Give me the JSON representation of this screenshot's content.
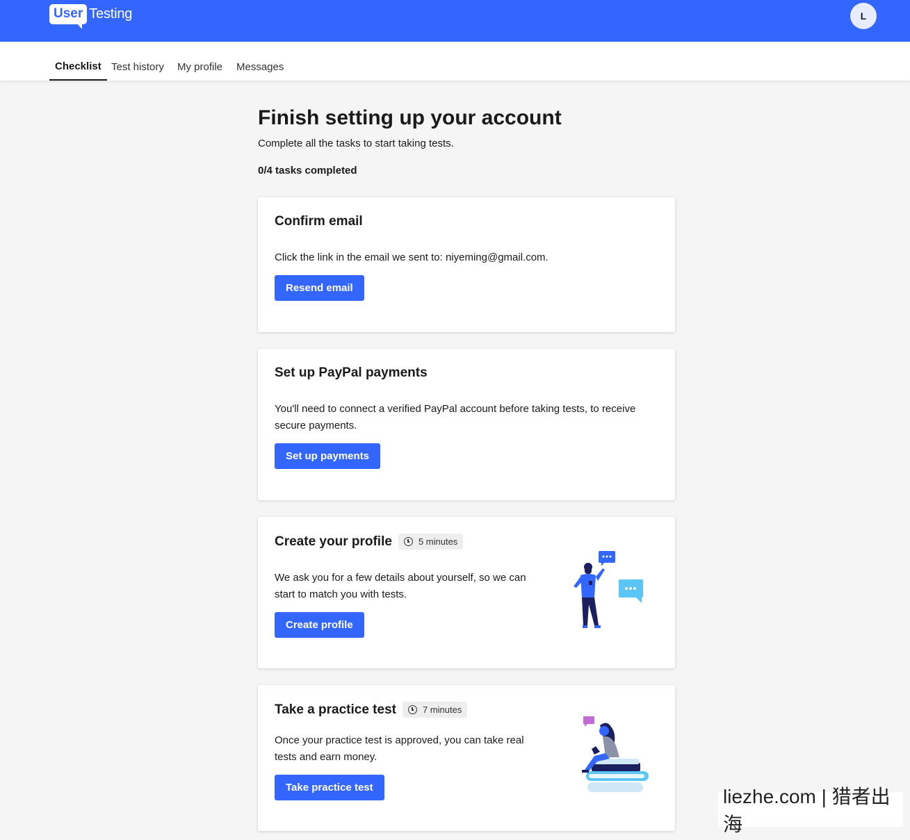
{
  "header": {
    "logo_user": "User",
    "logo_testing": "Testing",
    "avatar_initial": "L"
  },
  "tabs": [
    {
      "label": "Checklist",
      "active": true
    },
    {
      "label": "Test history",
      "active": false
    },
    {
      "label": "My profile",
      "active": false
    },
    {
      "label": "Messages",
      "active": false
    }
  ],
  "main": {
    "title": "Finish setting up your account",
    "subtitle": "Complete all the tasks to start taking tests.",
    "progress": "0/4 tasks completed"
  },
  "cards": [
    {
      "title": "Confirm email",
      "text": "Click the link in the email we sent to: niyeming@gmail.com.",
      "button": "Resend email"
    },
    {
      "title": "Set up PayPal payments",
      "text": "You'll need to connect a verified PayPal account before taking tests, to receive secure payments.",
      "button": "Set up payments"
    },
    {
      "title": "Create your profile",
      "badge": "5 minutes",
      "text": "We ask you for a few details about yourself, so we can start to match you with tests.",
      "button": "Create profile"
    },
    {
      "title": "Take a practice test",
      "badge": "7 minutes",
      "text": "Once your practice test is approved, you can take real tests and earn money.",
      "button": "Take practice test"
    }
  ],
  "watermark": "liezhe.com | 猎者出海",
  "colors": {
    "brand_blue": "#3366ff",
    "page_bg": "#f5f5f5",
    "card_bg": "#ffffff"
  }
}
